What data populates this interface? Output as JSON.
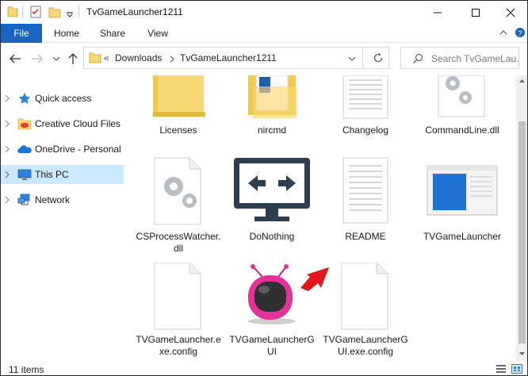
{
  "window": {
    "title": "TvGameLauncher1211"
  },
  "ribbon": {
    "tabs": [
      "File",
      "Home",
      "Share",
      "View"
    ]
  },
  "address": {
    "crumbs": [
      "Downloads",
      "TvGameLauncher1211"
    ],
    "search_placeholder": "Search TvGameLau..."
  },
  "nav": {
    "items": [
      {
        "label": "Quick access",
        "icon": "star-icon",
        "selected": false
      },
      {
        "label": "Creative Cloud Files",
        "icon": "creative-cloud-folder-icon",
        "selected": false
      },
      {
        "label": "OneDrive - Personal",
        "icon": "onedrive-cloud-icon",
        "selected": false
      },
      {
        "label": "This PC",
        "icon": "pc-monitor-icon",
        "selected": true
      },
      {
        "label": "Network",
        "icon": "network-icon",
        "selected": false
      }
    ]
  },
  "files": [
    {
      "label": "Licenses",
      "icon": "folder-icon"
    },
    {
      "label": "nircmd",
      "icon": "folder-with-document-icon"
    },
    {
      "label": "Changelog",
      "icon": "text-document-icon"
    },
    {
      "label": "CommandLine.dll",
      "icon": "dll-gears-icon"
    },
    {
      "label": "CSProcessWatcher.dll",
      "icon": "dll-gears-icon"
    },
    {
      "label": "DoNothing",
      "icon": "monitor-arrows-icon"
    },
    {
      "label": "README",
      "icon": "text-document-icon"
    },
    {
      "label": "TVGameLauncher",
      "icon": "window-thumbnail-icon"
    },
    {
      "label": "TVGameLauncher.exe.config",
      "icon": "blank-document-icon"
    },
    {
      "label": "TVGameLauncherGUI",
      "icon": "pink-tv-icon"
    },
    {
      "label": "TVGameLauncherGUI.exe.config",
      "icon": "blank-document-icon"
    }
  ],
  "status": {
    "item_count": "11 items"
  },
  "colors": {
    "accent": "#1a65c0",
    "selection": "#cce8ff",
    "arrow_annotation": "#e3161b"
  }
}
